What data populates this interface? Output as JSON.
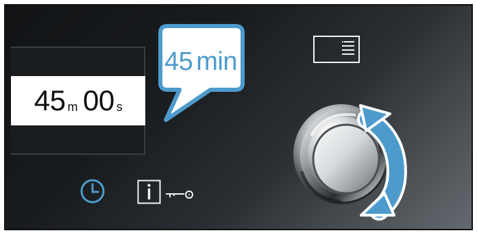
{
  "display": {
    "minutes": "45",
    "minutes_unit": "m",
    "seconds": "00",
    "seconds_unit": "s"
  },
  "callout": {
    "duration": "45",
    "unit": "min"
  },
  "icons": {
    "menu": "menu-lines-icon",
    "clock": "clock-icon",
    "info": "info-icon",
    "key": "key-icon",
    "rotate": "rotate-arrows-icon"
  },
  "colors": {
    "accent_blue": "#4d9bcc",
    "panel_dark": "#1a1d20",
    "display_bg": "#ffffff"
  }
}
